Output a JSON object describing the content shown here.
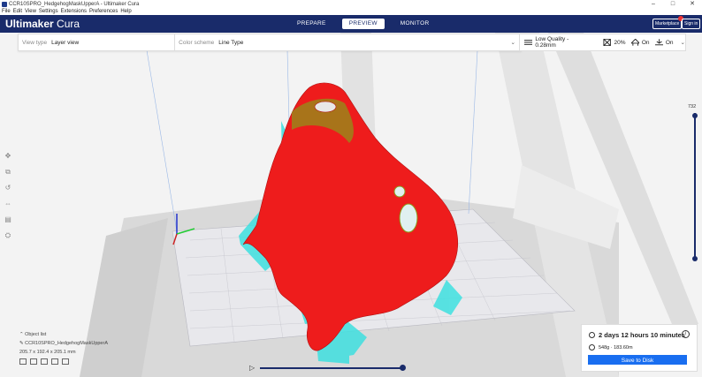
{
  "window": {
    "title": "CCR10SPRO_HedgehogMaskUpperA - Ultimaker Cura",
    "controls": [
      "–",
      "□",
      "✕"
    ]
  },
  "menu": [
    "File",
    "Edit",
    "View",
    "Settings",
    "Extensions",
    "Preferences",
    "Help"
  ],
  "header": {
    "brand_bold": "Ultimaker",
    "brand_light": " Cura",
    "stages": [
      "PREPARE",
      "PREVIEW",
      "MONITOR"
    ],
    "active_stage": "PREVIEW",
    "marketplace": "Marketplace",
    "signin": "Sign in"
  },
  "view": {
    "view_type_label": "View type",
    "view_type_value": "Layer view",
    "color_scheme_label": "Color scheme",
    "color_scheme_value": "Line Type"
  },
  "print": {
    "profile": "Low Quality - 0.28mm",
    "infill": "20%",
    "support": "On",
    "adhesion": "On"
  },
  "layer_slider": {
    "max_layer": "732"
  },
  "objects": {
    "header": "Object list",
    "name": "CCR10SPRO_HedgehogMaskUpperA",
    "dimensions": "205.7 x 192.4 x 205.1 mm"
  },
  "estimate": {
    "time": "2 days 12 hours 10 minutes",
    "material": "548g · 183.60m",
    "save_label": "Save to Disk"
  },
  "colors": {
    "header": "#192b6a",
    "model": "#ee1c1c",
    "support": "#3ee0e0",
    "accent": "#196ef0"
  }
}
